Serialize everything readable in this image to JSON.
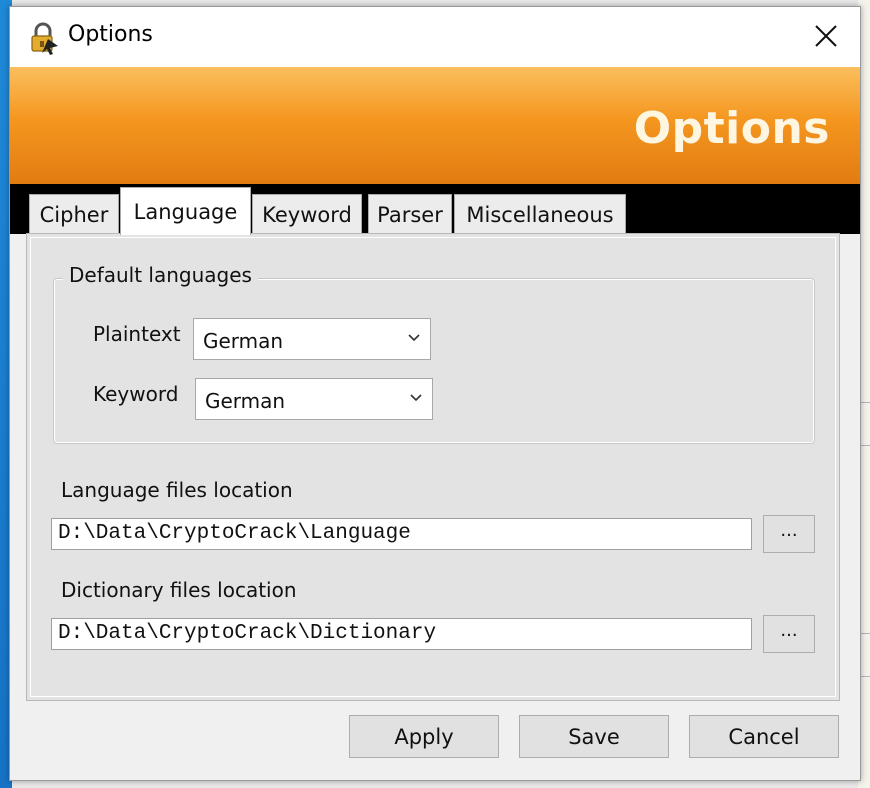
{
  "window": {
    "title": "Options",
    "icon": "padlock-icon",
    "close_icon": "close-icon"
  },
  "banner": {
    "title": "Options",
    "gradient_colors": [
      "#fbbf5d",
      "#e27c12"
    ]
  },
  "tabs": [
    {
      "label": "Cipher",
      "active": false
    },
    {
      "label": "Language",
      "active": true
    },
    {
      "label": "Keyword",
      "active": false
    },
    {
      "label": "Parser",
      "active": false
    },
    {
      "label": "Miscellaneous",
      "active": false
    }
  ],
  "language_tab": {
    "default_languages": {
      "legend": "Default languages",
      "plaintext": {
        "label": "Plaintext",
        "value": "German"
      },
      "keyword": {
        "label": "Keyword",
        "value": "German"
      }
    },
    "language_files": {
      "label": "Language files location",
      "value": "D:\\Data\\CryptoCrack\\Language",
      "browse_label": "..."
    },
    "dictionary_files": {
      "label": "Dictionary files location",
      "value": "D:\\Data\\CryptoCrack\\Dictionary",
      "browse_label": "..."
    }
  },
  "buttons": {
    "apply": "Apply",
    "save": "Save",
    "cancel": "Cancel"
  }
}
